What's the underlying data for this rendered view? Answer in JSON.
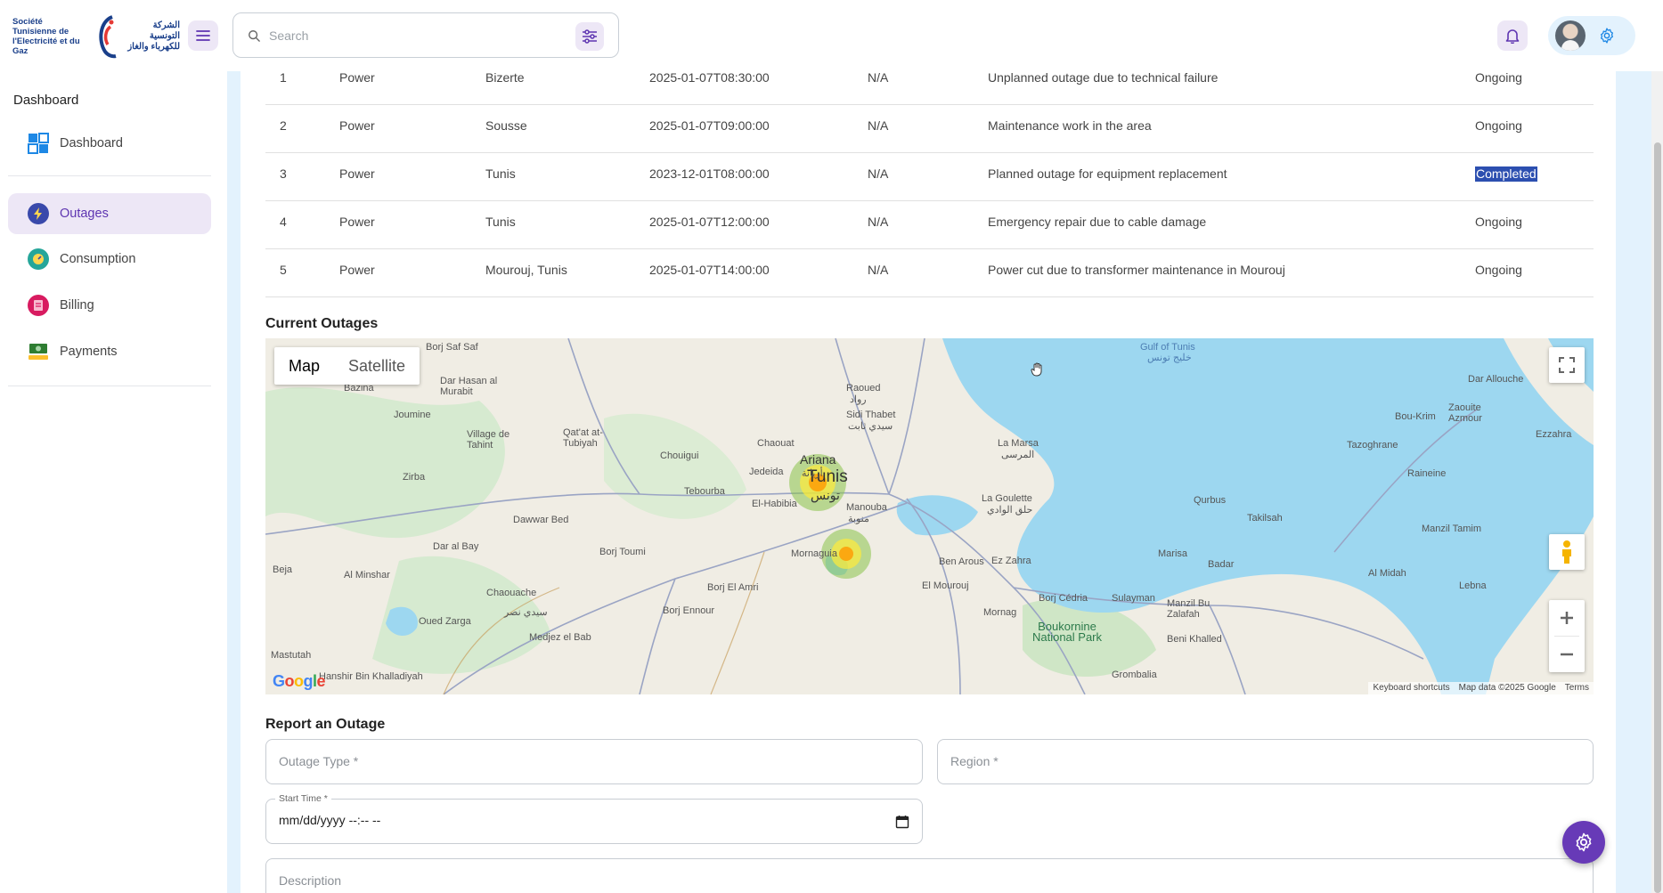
{
  "brand": {
    "logo_fr": "Société Tunisienne de l'Electricité et du Gaz",
    "logo_ar": "الشركة التونسية للكهرباء والغاز"
  },
  "search": {
    "placeholder": "Search"
  },
  "sidebar": {
    "caption": "Dashboard",
    "items": [
      {
        "label": "Dashboard",
        "icon": "dashboard-grid-icon",
        "active": false
      },
      {
        "label": "Outages",
        "icon": "outage-icon",
        "active": true
      },
      {
        "label": "Consumption",
        "icon": "consumption-icon",
        "active": false
      },
      {
        "label": "Billing",
        "icon": "billing-icon",
        "active": false
      },
      {
        "label": "Payments",
        "icon": "payments-icon",
        "active": false
      }
    ]
  },
  "table": {
    "rows": [
      {
        "id": "1",
        "type": "Power",
        "region": "Bizerte",
        "start": "2025-01-07T08:30:00",
        "end": "N/A",
        "description": "Unplanned outage due to technical failure",
        "status": "Ongoing"
      },
      {
        "id": "2",
        "type": "Power",
        "region": "Sousse",
        "start": "2025-01-07T09:00:00",
        "end": "N/A",
        "description": "Maintenance work in the area",
        "status": "Ongoing"
      },
      {
        "id": "3",
        "type": "Power",
        "region": "Tunis",
        "start": "2023-12-01T08:00:00",
        "end": "N/A",
        "description": "Planned outage for equipment replacement",
        "status": "Completed"
      },
      {
        "id": "4",
        "type": "Power",
        "region": "Tunis",
        "start": "2025-01-07T12:00:00",
        "end": "N/A",
        "description": "Emergency repair due to cable damage",
        "status": "Ongoing"
      },
      {
        "id": "5",
        "type": "Power",
        "region": "Mourouj, Tunis",
        "start": "2025-01-07T14:00:00",
        "end": "N/A",
        "description": "Power cut due to transformer maintenance in Mourouj",
        "status": "Ongoing"
      }
    ]
  },
  "map_section": {
    "title": "Current Outages",
    "toggle_map": "Map",
    "toggle_satellite": "Satellite",
    "footer": {
      "shortcuts": "Keyboard shortcuts",
      "data": "Map data ©2025 Google",
      "terms": "Terms"
    },
    "google": "Google",
    "places": {
      "tunis": "Tunis",
      "tunis_ar": "تونس",
      "ariana": "Ariana",
      "ariana_ar": "أريانة",
      "raoued": "Raoued",
      "raoued_ar": "رواد",
      "la_marsa": "La Marsa",
      "la_marsa_ar": "المرسى",
      "la_goulette": "La Goulette",
      "la_goulette_ar": "حلق الوادي",
      "ben_arous": "Ben Arous",
      "ez_zahra": "Ez Zahra",
      "mourouj": "El Mourouj",
      "mornag": "Mornag",
      "manouba": "Manouba",
      "manouba_ar": "منوبة",
      "sidi_thabet": "Sidi Thabet",
      "sidi_thabet_ar": "سيدي ثابت",
      "chaouat": "Chaouat",
      "jedeida": "Jedeida",
      "tebourba": "Tebourba",
      "el_habibia": "El-Habibia",
      "mornaguia": "Mornaguia",
      "borj_el_amri": "Borj El Amri",
      "borj_ennour": "Borj Ennour",
      "borj_toumi": "Borj Toumi",
      "chouigui": "Chouigui",
      "dawwar_bed": "Dawwar Bed",
      "dar_al_bay": "Dar al Bay",
      "chaouache": "Chaouache",
      "sidi_nasr_ar": "سيدي نصر",
      "medjez": "Medjez el Bab",
      "oued_zarga": "Oued Zarga",
      "mastutah": "Mastutah",
      "hanshir": "Hanshir Bin Khalladiyah",
      "al_minshar": "Al Minshar",
      "beja": "Beja",
      "zirba": "Zirba",
      "joumine": "Joumine",
      "bazina": "Bazina",
      "dar_hasan": "Dar Hasan al Murabit",
      "village_tahint": "Village de Tahint",
      "qatat": "Qat'at at-Tubiyah",
      "borj_saf": "Borj Saf Saf",
      "gulf": "Gulf of Tunis",
      "gulf_ar": "خليج تونس",
      "dar_allouche": "Dar Allouche",
      "bou_krim": "Bou-Krim",
      "zaouite": "Zaouite Azmour",
      "ezzahra": "Ezzahra",
      "tazoghrane": "Tazoghrane",
      "raineine": "Raineine",
      "qurbus": "Qurbus",
      "takilsah": "Takilsah",
      "manzil_tamim": "Manzil Tamim",
      "al_midah": "Al Midah",
      "lebna": "Lebna",
      "marisa": "Marisa",
      "badar": "Badar",
      "borj_cedria": "Borj Cédria",
      "sulayman": "Sulayman",
      "manzil_bu": "Manzil Bu Zalafah",
      "beni_khalled": "Beni Khalled",
      "grombalia": "Grombalia",
      "boukornine": "Boukornine National Park"
    }
  },
  "form": {
    "title": "Report an Outage",
    "outage_type": "Outage Type *",
    "region": "Region *",
    "start_label": "Start Time *",
    "start_value": "mm/dd/yyyy --:-- --",
    "description": "Description"
  },
  "colors": {
    "accent": "#673ab7",
    "accent_light": "#ede7f6",
    "main_bg": "#e3f2fd",
    "selection": "#2c4fb0"
  }
}
